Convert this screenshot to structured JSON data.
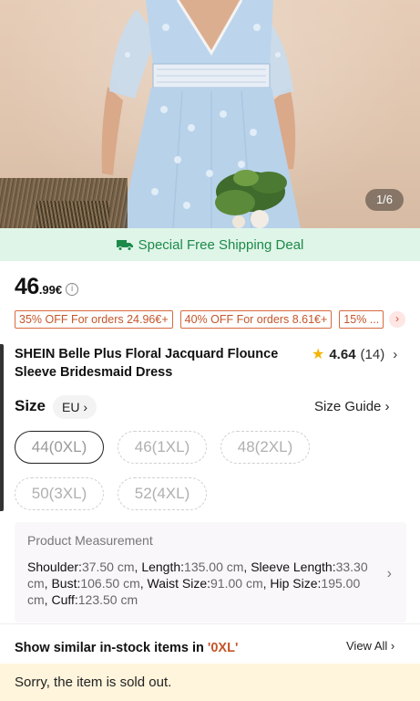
{
  "gallery": {
    "counter": "1/6"
  },
  "shipping": {
    "text": "Special Free Shipping Deal"
  },
  "price": {
    "integer": "46",
    "decimal": ".99€"
  },
  "coupons": [
    "35% OFF For orders 24.96€+",
    "40% OFF For orders 8.61€+",
    "15% ..."
  ],
  "product": {
    "title": "SHEIN Belle Plus Floral Jacquard Flounce Sleeve Bridesmaid Dress",
    "rating": "4.64",
    "review_count": "(14)"
  },
  "size": {
    "label": "Size",
    "region": "EU",
    "guide": "Size Guide",
    "options": [
      "44(0XL)",
      "46(1XL)",
      "48(2XL)",
      "50(3XL)",
      "52(4XL)"
    ],
    "selected": "44(0XL)"
  },
  "measurement": {
    "title": "Product Measurement",
    "shoulder_label": "Shoulder:",
    "shoulder": "37.50 cm",
    "length_label": "Length:",
    "length": "135.00 cm",
    "sleeve_label": "Sleeve Length:",
    "sleeve": "33.30 cm",
    "bust_label": "Bust:",
    "bust": "106.50 cm",
    "waist_label": "Waist Size:",
    "waist": "91.00 cm",
    "hip_label": "Hip Size:",
    "hip": "195.00 cm",
    "cuff_label": "Cuff:",
    "cuff": "123.50 cm"
  },
  "similar": {
    "prefix": "Show similar in-stock items in ",
    "size": "'0XL'",
    "view_all": "View All"
  },
  "soldout": {
    "text": "Sorry, the item is sold out."
  },
  "colors": {
    "accent_green": "#1d8a4a",
    "coupon_orange": "#c4552a",
    "star": "#f5b400",
    "soldout_bg": "#fff4dc"
  },
  "icons": [
    "truck-icon",
    "info-icon",
    "star-icon",
    "chevron-right-icon"
  ]
}
